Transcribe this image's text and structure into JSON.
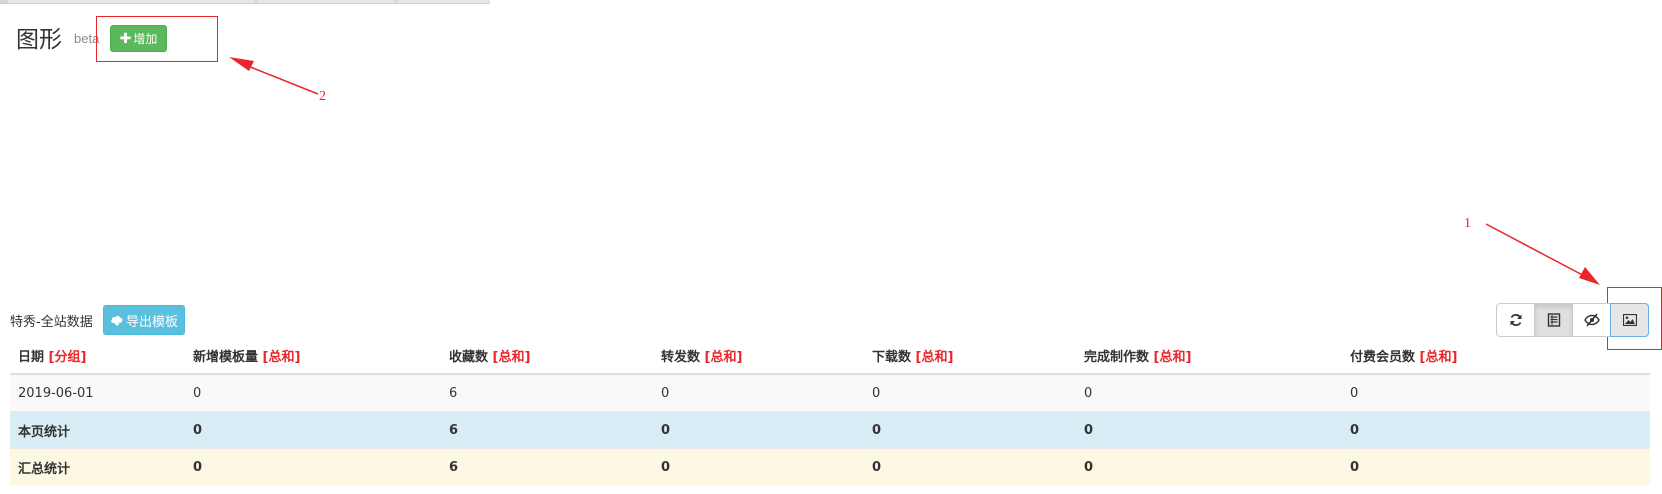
{
  "chart_section": {
    "title": "图形",
    "badge": "beta",
    "add_button": {
      "icon": "plus-icon",
      "label": "增加"
    }
  },
  "annotations": {
    "label_1": "1",
    "label_2": "2",
    "color": "#e8262b"
  },
  "table_section": {
    "caption": "特秀-全站数据",
    "export_button": {
      "icon": "cloud-download-icon",
      "label": "导出模板"
    },
    "toolbar": [
      {
        "name": "refresh-icon"
      },
      {
        "name": "list-view-icon"
      },
      {
        "name": "eye-toggle-icon"
      },
      {
        "name": "image-icon"
      }
    ],
    "columns": [
      {
        "label": "日期",
        "tag": "[分组]"
      },
      {
        "label": "新增模板量",
        "tag": "[总和]"
      },
      {
        "label": "收藏数",
        "tag": "[总和]"
      },
      {
        "label": "转发数",
        "tag": "[总和]"
      },
      {
        "label": "下载数",
        "tag": "[总和]"
      },
      {
        "label": "完成制作数",
        "tag": "[总和]"
      },
      {
        "label": "付费会员数",
        "tag": "[总和]"
      }
    ],
    "rows": [
      {
        "cells": [
          "2019-06-01",
          "0",
          "6",
          "0",
          "0",
          "0",
          "0"
        ]
      },
      {
        "cells": [
          "本页统计",
          "0",
          "6",
          "0",
          "0",
          "0",
          "0"
        ]
      },
      {
        "cells": [
          "汇总统计",
          "0",
          "6",
          "0",
          "0",
          "0",
          "0"
        ]
      }
    ]
  },
  "colors": {
    "success": "#5cb85c",
    "info": "#5bc0de",
    "accent_red": "#e8262b",
    "row_page_bg": "#d9edf7",
    "row_total_bg": "#fcf8e3"
  }
}
